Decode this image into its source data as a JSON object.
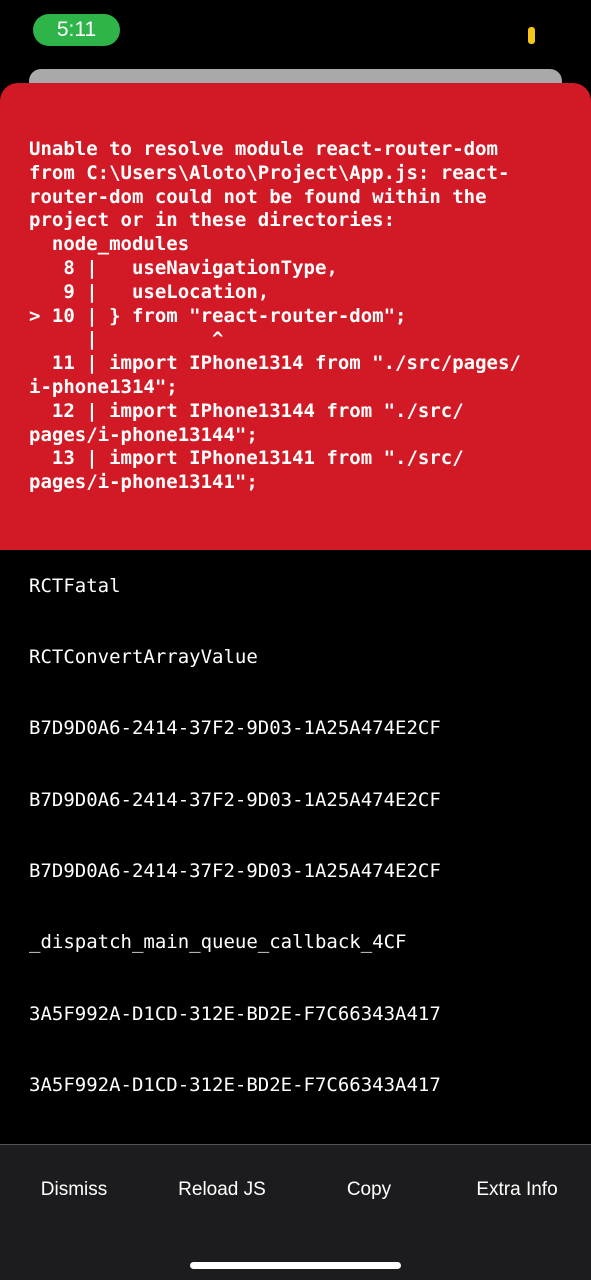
{
  "status_bar": {
    "time": "5:11",
    "time_pill_color": "#2fb44a",
    "battery_color": "#f5c518"
  },
  "error": {
    "background_color": "#d11a26",
    "message": "Unable to resolve module react-router-dom\nfrom C:\\Users\\Aloto\\Project\\App.js: react-\nrouter-dom could not be found within the\nproject or in these directories:\n  node_modules\n   8 |   useNavigationType,\n   9 |   useLocation,\n> 10 | } from \"react-router-dom\";\n     |          ^\n  11 | import IPhone1314 from \"./src/pages/\ni-phone1314\";\n  12 | import IPhone13144 from \"./src/\npages/i-phone13144\";\n  13 | import IPhone13141 from \"./src/\npages/i-phone13141\";"
  },
  "stack": [
    "RCTFatal",
    "RCTConvertArrayValue",
    "B7D9D0A6-2414-37F2-9D03-1A25A474E2CF",
    "B7D9D0A6-2414-37F2-9D03-1A25A474E2CF",
    "B7D9D0A6-2414-37F2-9D03-1A25A474E2CF",
    "_dispatch_main_queue_callback_4CF",
    "3A5F992A-D1CD-312E-BD2E-F7C66343A417",
    "3A5F992A-D1CD-312E-BD2E-F7C66343A417"
  ],
  "toolbar": {
    "dismiss_label": "Dismiss",
    "reload_label": "Reload JS",
    "copy_label": "Copy",
    "extra_info_label": "Extra Info"
  }
}
